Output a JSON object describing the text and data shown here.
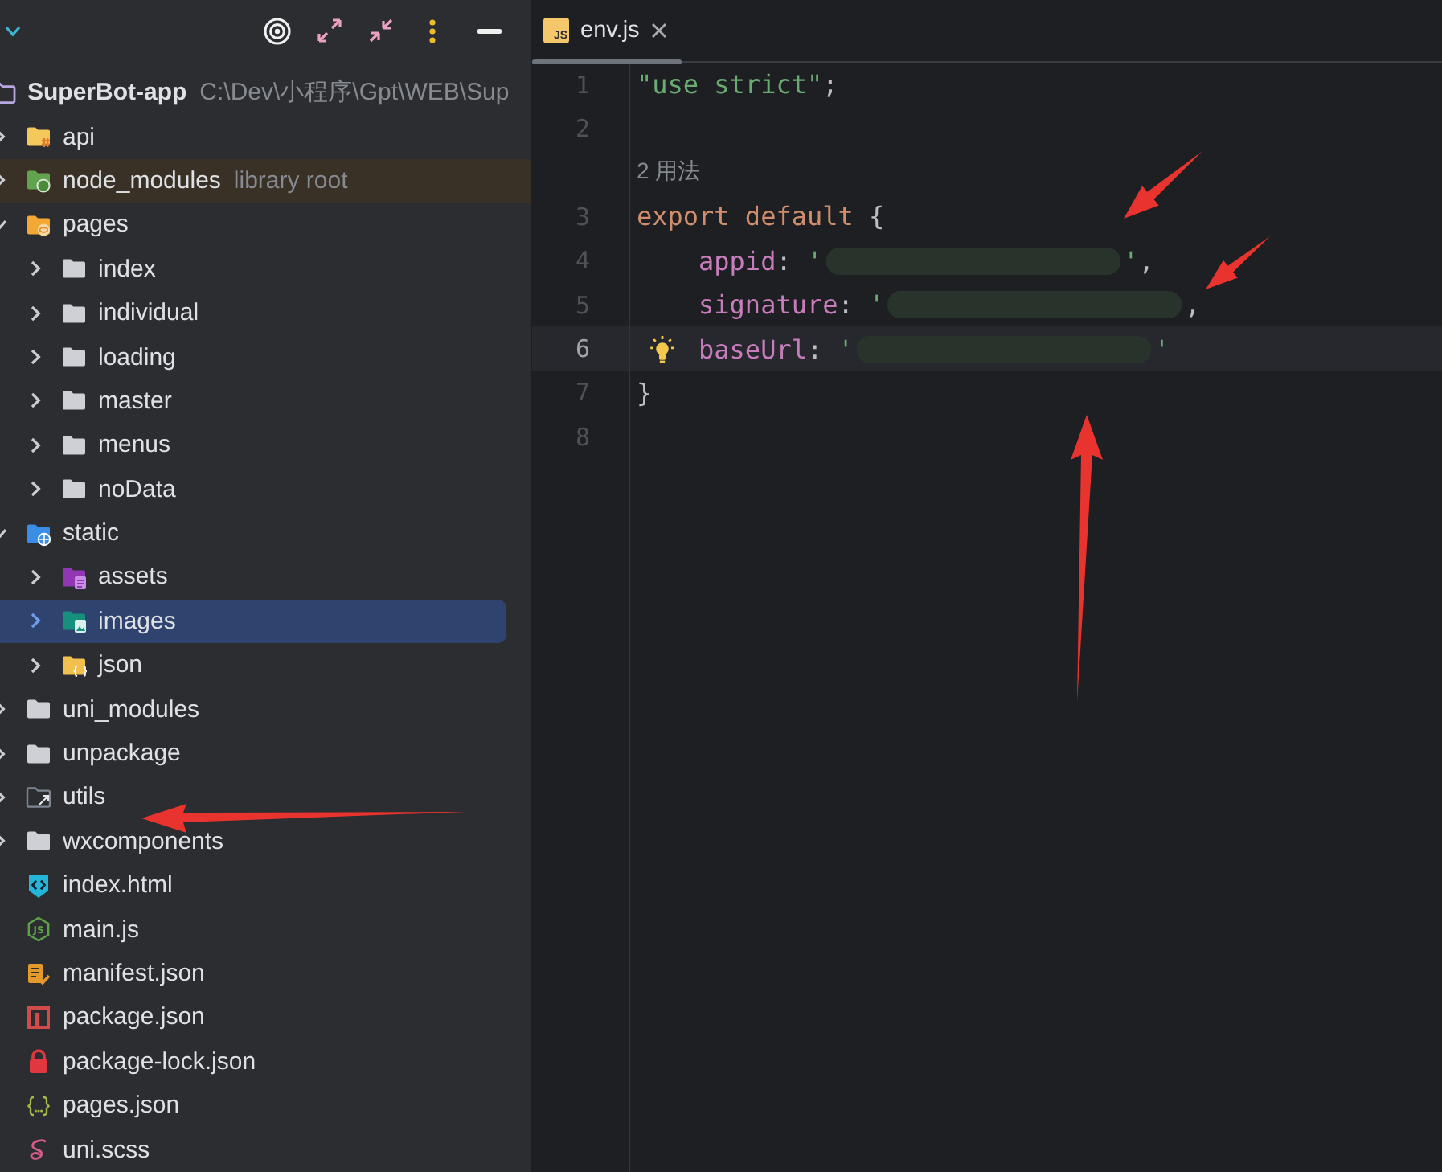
{
  "project_tree": {
    "root": {
      "name": "SuperBot-app",
      "kind": "project",
      "path": "C:\\Dev\\小程序\\Gpt\\WEB\\Sup",
      "selected": false,
      "children": [
        {
          "name": "api",
          "kind": "module",
          "expanded": false,
          "selected": false
        },
        {
          "name": "node_modules",
          "kind": "library",
          "note": "library root",
          "expanded": false,
          "selected": false
        },
        {
          "name": "pages",
          "kind": "pages",
          "expanded": true,
          "selected": false,
          "children": [
            {
              "name": "index",
              "kind": "folder",
              "expanded": false,
              "selected": false
            },
            {
              "name": "individual",
              "kind": "folder",
              "expanded": false,
              "selected": false
            },
            {
              "name": "loading",
              "kind": "folder",
              "expanded": false,
              "selected": false
            },
            {
              "name": "master",
              "kind": "folder",
              "expanded": false,
              "selected": false
            },
            {
              "name": "menus",
              "kind": "folder",
              "expanded": false,
              "selected": false
            },
            {
              "name": "noData",
              "kind": "folder",
              "expanded": false,
              "selected": false
            }
          ]
        },
        {
          "name": "static",
          "kind": "web",
          "expanded": true,
          "selected": false,
          "children": [
            {
              "name": "assets",
              "kind": "assets",
              "expanded": false,
              "selected": false
            },
            {
              "name": "images",
              "kind": "images",
              "expanded": false,
              "selected": true
            },
            {
              "name": "json",
              "kind": "data",
              "expanded": false,
              "selected": false
            }
          ]
        },
        {
          "name": "uni_modules",
          "kind": "folder",
          "expanded": false,
          "selected": false
        },
        {
          "name": "unpackage",
          "kind": "folder",
          "expanded": false,
          "selected": false
        },
        {
          "name": "utils",
          "kind": "excluded",
          "expanded": false,
          "selected": false
        },
        {
          "name": "wxcomponents",
          "kind": "folder",
          "expanded": false,
          "selected": false
        },
        {
          "name": "index.html",
          "kind": "html",
          "selected": false
        },
        {
          "name": "main.js",
          "kind": "script",
          "badge": "JS",
          "selected": false
        },
        {
          "name": "manifest.json",
          "kind": "manifest",
          "selected": false
        },
        {
          "name": "package.json",
          "kind": "package",
          "selected": false
        },
        {
          "name": "package-lock.json",
          "kind": "lock",
          "selected": false
        },
        {
          "name": "pages.json",
          "kind": "config",
          "selected": false
        },
        {
          "name": "uni.scss",
          "kind": "style",
          "selected": false
        }
      ]
    }
  },
  "editor": {
    "tabs": [
      {
        "label": "env.js",
        "icon_text": "JS",
        "selected": true
      }
    ],
    "lines": [
      {
        "kind": "code",
        "number": "1",
        "current": false,
        "tokens": [
          {
            "kind": "string",
            "text": "\"use strict\""
          },
          {
            "kind": "punct",
            "text": ";"
          }
        ]
      },
      {
        "kind": "code",
        "number": "2",
        "current": false
      },
      {
        "kind": "hint",
        "text": "2 用法"
      },
      {
        "kind": "code",
        "number": "3",
        "current": false,
        "tokens": [
          {
            "kind": "keyword",
            "text": "export default"
          },
          {
            "kind": "punct",
            "text": " {"
          }
        ],
        "children": [
          {
            "kind": "code",
            "number": "4",
            "current": false,
            "tokens": [
              {
                "kind": "property",
                "text": "appid"
              },
              {
                "kind": "punct",
                "text": ": "
              },
              {
                "kind": "string",
                "text": "'"
              },
              {
                "kind": "redacted"
              },
              {
                "kind": "string",
                "text": "'"
              },
              {
                "kind": "punct",
                "text": ","
              }
            ]
          },
          {
            "kind": "code",
            "number": "5",
            "current": false,
            "tokens": [
              {
                "kind": "property",
                "text": "signature"
              },
              {
                "kind": "punct",
                "text": ": "
              },
              {
                "kind": "string",
                "text": "'"
              },
              {
                "kind": "redacted"
              },
              {
                "kind": "punct",
                "text": ","
              }
            ]
          },
          {
            "kind": "code",
            "number": "6",
            "current": true,
            "bulb": true,
            "tokens": [
              {
                "kind": "property",
                "text": "baseUrl"
              },
              {
                "kind": "punct",
                "text": ": "
              },
              {
                "kind": "string",
                "text": "'"
              },
              {
                "kind": "redacted"
              },
              {
                "kind": "string",
                "text": "'"
              }
            ]
          }
        ]
      },
      {
        "kind": "code",
        "number": "7",
        "current": false,
        "tokens": [
          {
            "kind": "punct",
            "text": "}"
          }
        ]
      },
      {
        "kind": "code",
        "number": "8",
        "current": false
      }
    ]
  }
}
